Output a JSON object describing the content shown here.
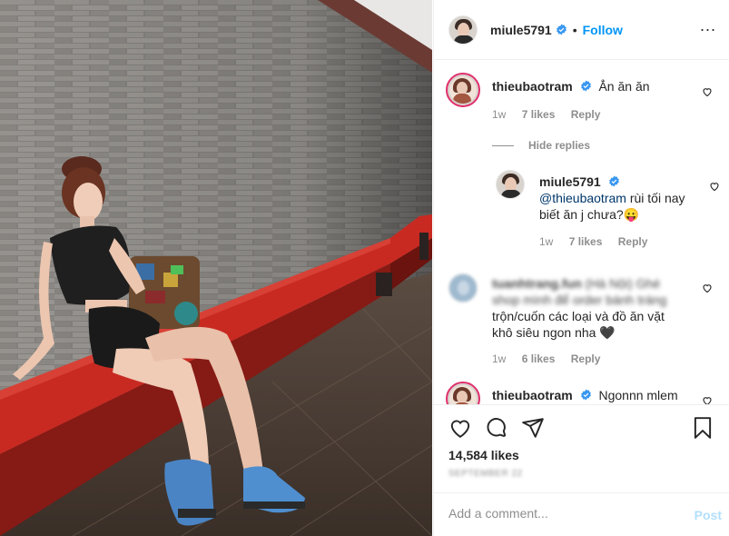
{
  "post_header": {
    "username": "miule5791",
    "dot": "•",
    "follow_label": "Follow",
    "more_label": "..."
  },
  "comments": [
    {
      "username": "thieubaotram",
      "text": "Ẳn ăn ăn",
      "time": "1w",
      "likes": "7 likes",
      "reply_label": "Reply"
    }
  ],
  "hide_replies_label": "Hide replies",
  "reply": {
    "username": "miule5791",
    "mention": "@thieubaotram",
    "text_after_mention": " rùi tối nay biết ăn j chưa?😛",
    "time": "1w",
    "likes": "7 likes",
    "reply_label": "Reply"
  },
  "comment_blurred": {
    "username_blurred": "tuanhtrang.fun",
    "text_blurred_prefix": "(Hà Nội) Ghé shop mình để order bánh tráng",
    "text_visible": "trộn/cuốn các loại và đồ ăn vặt khô siêu ngon nha 🖤",
    "time": "1w",
    "likes": "6 likes",
    "reply_label": "Reply"
  },
  "comment_last": {
    "username": "thieubaotram",
    "text": "Ngonnn mlem"
  },
  "actions": {
    "likes_count": "14,584 likes",
    "date_blurred": "SEPTEMBER 22",
    "add_comment_placeholder": "Add a comment...",
    "post_label": "Post"
  },
  "icons": [
    "heart-icon",
    "comment-icon",
    "share-icon",
    "bookmark-icon",
    "verified-badge-icon",
    "more-options-icon"
  ],
  "colors": {
    "follow_blue": "#0095f6",
    "post_disabled": "#b2dffc",
    "verified_blue": "#3897f0",
    "meta_gray": "#8e8e8e",
    "bench_red": "#b8211c"
  }
}
